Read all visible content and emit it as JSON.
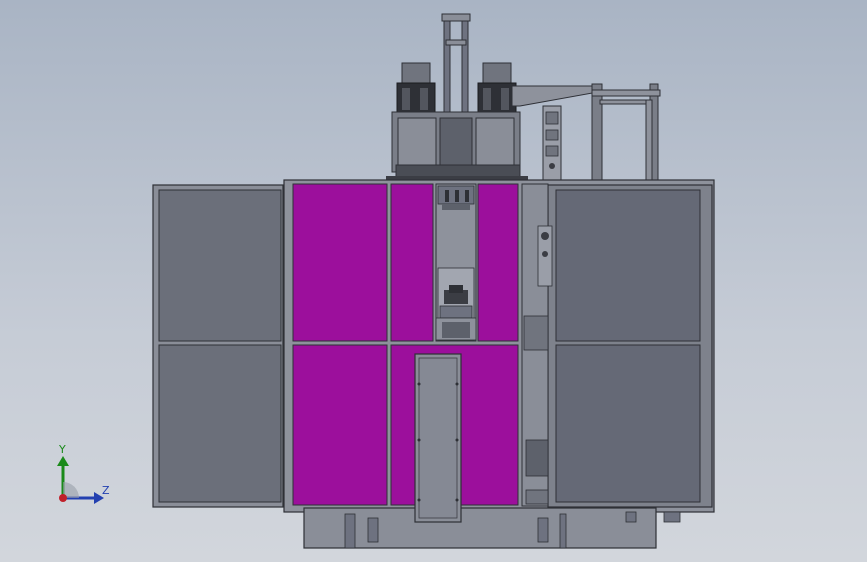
{
  "viewport": {
    "background_top": "#a9b4c4",
    "background_bottom": "#d2d6dc"
  },
  "model": {
    "panel_color_magenta": "#9c0f9c",
    "panel_color_gray": "#6a6e7a",
    "frame_color": "#5b5e66",
    "body_color": "#7e828c"
  },
  "triad": {
    "y_label": "Y",
    "z_label": "Z",
    "y_color": "#1a8a1a",
    "z_color": "#2340b0",
    "origin_color": "#c0202a"
  }
}
